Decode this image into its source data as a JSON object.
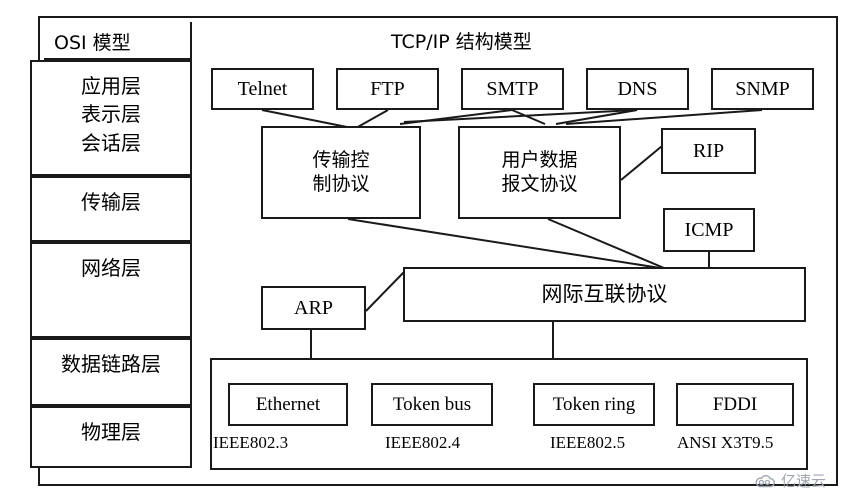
{
  "diagram": {
    "osi_title": "OSI 模型",
    "tcpip_title": "TCP/IP 结构模型",
    "osi_layers": [
      {
        "id": "application",
        "label": "应用层\n表示层\n会话层"
      },
      {
        "id": "transport",
        "label": "传输层"
      },
      {
        "id": "network",
        "label": "网络层"
      },
      {
        "id": "datalink",
        "label": "数据链路层"
      },
      {
        "id": "physical",
        "label": "物理层"
      }
    ],
    "application_protocols": [
      {
        "id": "telnet",
        "label": "Telnet"
      },
      {
        "id": "ftp",
        "label": "FTP"
      },
      {
        "id": "smtp",
        "label": "SMTP"
      },
      {
        "id": "dns",
        "label": "DNS"
      },
      {
        "id": "snmp",
        "label": "SNMP"
      }
    ],
    "transport_protocols": [
      {
        "id": "tcp",
        "label": "传输控\n制协议"
      },
      {
        "id": "udp",
        "label": "用户数据\n报文协议"
      },
      {
        "id": "rip",
        "label": "RIP"
      }
    ],
    "network_protocols": [
      {
        "id": "icmp",
        "label": "ICMP"
      },
      {
        "id": "arp",
        "label": "ARP"
      },
      {
        "id": "ip",
        "label": "网际互联协议"
      }
    ],
    "link_technologies": [
      {
        "id": "ethernet",
        "label": "Ethernet",
        "standard": "IEEE802.3"
      },
      {
        "id": "token-bus",
        "label": "Token bus",
        "standard": "IEEE802.4"
      },
      {
        "id": "token-ring",
        "label": "Token ring",
        "standard": "IEEE802.5"
      },
      {
        "id": "fddi",
        "label": "FDDI",
        "standard": "ANSI X3T9.5"
      }
    ],
    "watermark": {
      "text": "亿速云",
      "icon": "cloud-icon"
    },
    "colors": {
      "line": "#1a1a1a",
      "background": "#ffffff",
      "watermark": "#9aa3ad"
    }
  }
}
